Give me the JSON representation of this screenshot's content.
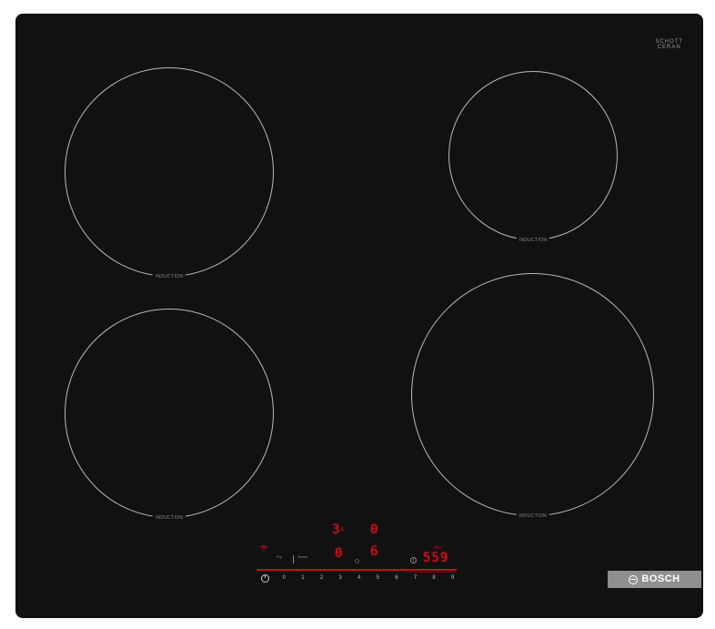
{
  "brand": {
    "name": "BOSCH",
    "glass_top_line": "SCHOTT",
    "glass_bottom_line": "CERAN",
    "glass_tagline": ""
  },
  "zones": [
    {
      "id": "front-left",
      "label": "INDUCTION"
    },
    {
      "id": "front-right",
      "label": "INDUCTION"
    },
    {
      "id": "rear-left",
      "label": "INDUCTION"
    },
    {
      "id": "rear-right",
      "label": "INDUCTION"
    }
  ],
  "display": {
    "top_left_readout": "3",
    "top_left_suffix": "s",
    "top_right_readout": "0",
    "mid_left_readout": "0",
    "mid_right_readout": "6",
    "timer_readout": "559",
    "timer_unit": "min"
  },
  "controls": {
    "mode_left": "Fry",
    "mode_right": "Sense",
    "levels": [
      "0",
      "1",
      "2",
      "3",
      "4",
      "5",
      "6",
      "7",
      "8",
      "9"
    ]
  },
  "colors": {
    "glass": "#111111",
    "ring": "#b9b9b9",
    "display_red": "#e0121b",
    "badge": "#8f8f8f"
  }
}
